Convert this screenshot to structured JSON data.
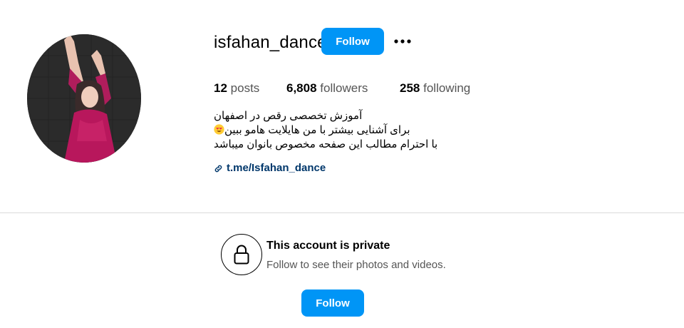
{
  "profile": {
    "username": "isfahan_dance",
    "follow_label": "Follow",
    "more_icon": "more-options-icon",
    "avatar_icon": "profile-photo"
  },
  "stats": {
    "posts_count": "12",
    "posts_label": "posts",
    "followers_count": "6,808",
    "followers_label": "followers",
    "following_count": "258",
    "following_label": "following"
  },
  "bio": {
    "line1": "آموزش تخصصی رقص در اصفهان",
    "line2": "برای آشنایی بیشتر با من هایلایت هامو ببین",
    "line2_emoji": "smiling-face-with-heart-eyes",
    "line3": "با احترام مطالب این صفحه مخصوص بانوان میباشد",
    "link_icon": "link-icon",
    "link": "t.me/Isfahan_dance"
  },
  "private": {
    "title": "This account is private",
    "subtitle": "Follow to see their photos and videos.",
    "follow_label": "Follow",
    "icon": "lock-icon"
  },
  "colors": {
    "primary_button": "#0095f6",
    "link": "#00376b",
    "divider": "#dbdbdb"
  }
}
